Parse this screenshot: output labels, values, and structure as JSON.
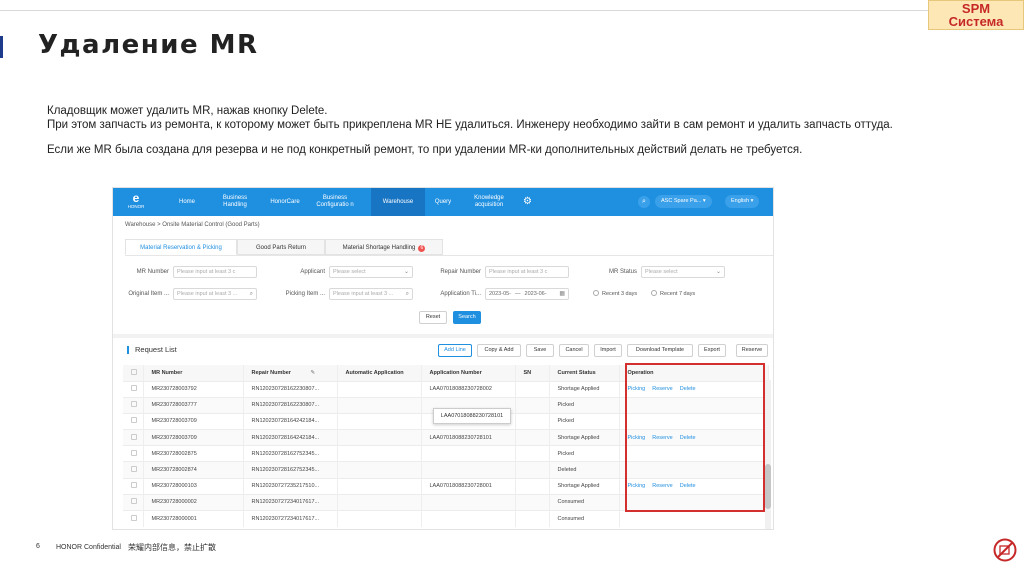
{
  "slide": {
    "title": "Удаление MR",
    "badge_line1": "SPM",
    "badge_line2": "Система",
    "paragraph1": "Кладовщик может удалить MR, нажав кнопку Delete.",
    "paragraph2": "При этом запчасть из ремонта, к которому может быть прикреплена MR НЕ удалиться. Инженеру необходимо зайти в сам ремонт и удалить запчасть оттуда.",
    "paragraph3": "Если же MR была создана для резерва и не под конкретный ремонт, то при удалении MR-ки дополнительных действий делать не требуется.",
    "footer_page": "6",
    "footer_confidential": "HONOR Confidential",
    "footer_cn": "荣耀内部信息，禁止扩散",
    "colors": {
      "title_accent": "#1e3a8a",
      "badge_bg": "#fde8b5",
      "badge_text": "#c62828",
      "highlight": "#d32f2f",
      "brand": "#1f8fe0"
    }
  },
  "app": {
    "logo_mark": "e",
    "logo_text": "HONOR",
    "nav": {
      "home": "Home",
      "business_handling": "Business Handling",
      "honorcare": "HonorCare",
      "business_config": "Business Configuratio n",
      "warehouse": "Warehouse",
      "query": "Query",
      "knowledge": "Knowledge acquisition",
      "gear_icon": "gear-icon",
      "search_icon": "search-icon",
      "account": "ASC Spare Pa... ▾",
      "language": "English ▾"
    },
    "breadcrumb": "Warehouse  >  Onsite Material Control (Good Parts)",
    "tabs": {
      "reservation": "Material Reservation & Picking",
      "good_parts": "Good Parts Return",
      "shortage": "Material Shortage Handling",
      "shortage_badge": "6"
    },
    "filters": {
      "mr_number_label": "MR Number",
      "mr_number_ph": "Please input at least 3 c",
      "applicant_label": "Applicant",
      "applicant_ph": "Please select",
      "repair_number_label": "Repair Number",
      "repair_number_ph": "Please input at least 3 c",
      "mr_status_label": "MR Status",
      "mr_status_ph": "Please select",
      "original_item_label": "Original Item ...",
      "original_item_ph": "Please input at least 3 ...",
      "picking_item_label": "Picking Item ...",
      "picking_item_ph": "Please input at least 3 ...",
      "application_time_label": "Application Ti...",
      "date_from": "2023-05-",
      "date_to": "2023-06-",
      "recent3": "Recent 3 days",
      "recent7": "Recent 7 days",
      "reset": "Reset",
      "search": "Search"
    },
    "list": {
      "title": "Request List",
      "add_line": "Add Line",
      "copy_add": "Copy & Add",
      "save": "Save",
      "cancel": "Cancel",
      "import": "Import",
      "download_template": "Download Template",
      "export": "Export",
      "reserve": "Reserve"
    },
    "columns": {
      "mr_number": "MR Number",
      "repair_number": "Repair Number",
      "automatic_application": "Automatic Application",
      "application_number": "Application Number",
      "sn": "SN",
      "current_status": "Current Status",
      "operation": "Operation"
    },
    "rows": [
      {
        "mr": "MR230728003792",
        "repair": "RN120230728162230807...",
        "app": "LAA07018088230728002",
        "status": "Shortage Applied",
        "status_cls": "st-red",
        "ops": [
          "Picking",
          "Reserve",
          "Delete"
        ]
      },
      {
        "mr": "MR230728003777",
        "repair": "RN120230728162230807...",
        "app": "",
        "status": "Picked",
        "status_cls": "st-orange",
        "ops": []
      },
      {
        "mr": "MR230728003709",
        "repair": "RN120230728164242184...",
        "app": "",
        "status": "Picked",
        "status_cls": "st-orange",
        "ops": []
      },
      {
        "mr": "MR230728003709",
        "repair": "RN120230728164242184...",
        "app": "LAA07018088230728101",
        "status": "Shortage Applied",
        "status_cls": "st-red",
        "ops": [
          "Picking",
          "Reserve",
          "Delete"
        ]
      },
      {
        "mr": "MR230728002875",
        "repair": "RN120230728162752345...",
        "app": "",
        "status": "Picked",
        "status_cls": "st-orange",
        "ops": []
      },
      {
        "mr": "MR230728002874",
        "repair": "RN120230728162752345...",
        "app": "",
        "status": "Deleted",
        "status_cls": "st-grey",
        "ops": []
      },
      {
        "mr": "MR230728000103",
        "repair": "RN120230727235217510...",
        "app": "LAA07018088230728001",
        "status": "Shortage Applied",
        "status_cls": "st-red",
        "ops": [
          "Picking",
          "Reserve",
          "Delete"
        ]
      },
      {
        "mr": "MR230728000002",
        "repair": "RN120230727234017617...",
        "app": "",
        "status": "Consumed",
        "status_cls": "st-grey",
        "ops": []
      },
      {
        "mr": "MR230728000001",
        "repair": "RN120230727234017617...",
        "app": "",
        "status": "Consumed",
        "status_cls": "st-grey",
        "ops": []
      }
    ],
    "tooltip": "LAA07018088230728101"
  }
}
